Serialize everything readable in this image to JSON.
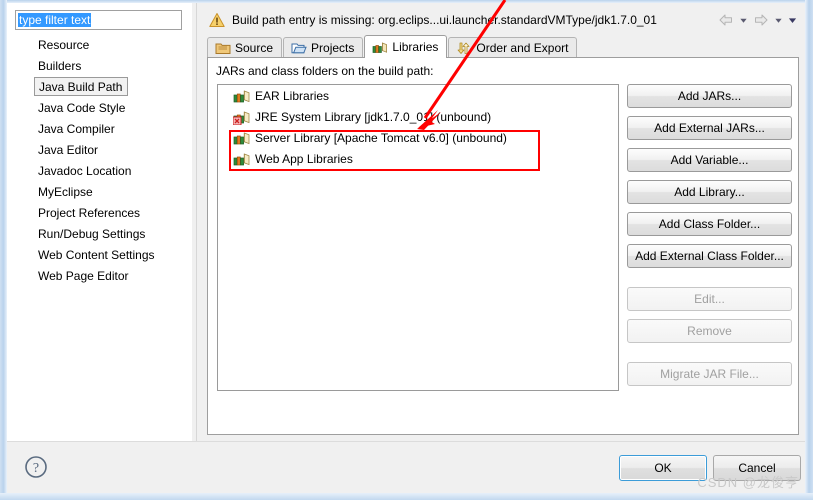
{
  "window": {
    "help_icon": "question-circle-icon",
    "watermark": "CSDN @龙俊亨"
  },
  "sidebar": {
    "filter": {
      "value": "type filter text",
      "placeholder": "type filter text",
      "selected": true
    },
    "items": [
      {
        "label": "Resource",
        "selected": false
      },
      {
        "label": "Builders",
        "selected": false
      },
      {
        "label": "Java Build Path",
        "selected": true
      },
      {
        "label": "Java Code Style",
        "selected": false
      },
      {
        "label": "Java Compiler",
        "selected": false
      },
      {
        "label": "Java Editor",
        "selected": false
      },
      {
        "label": "Javadoc Location",
        "selected": false
      },
      {
        "label": "MyEclipse",
        "selected": false
      },
      {
        "label": "Project References",
        "selected": false
      },
      {
        "label": "Run/Debug Settings",
        "selected": false
      },
      {
        "label": "Web Content Settings",
        "selected": false
      },
      {
        "label": "Web Page Editor",
        "selected": false
      }
    ]
  },
  "message_bar": {
    "icon": "warning-triangle-icon",
    "text": "Build path entry is missing: org.eclips...ui.launcher.standardVMType/jdk1.7.0_01",
    "nav": {
      "back_icon": "back-arrow-icon",
      "back_menu_icon": "chevron-down-icon",
      "forward_icon": "forward-arrow-icon",
      "forward_menu_icon": "chevron-down-icon",
      "more_icon": "chevron-down-icon"
    }
  },
  "tabs": [
    {
      "label": "Source",
      "icon": "source-folder-icon",
      "active": false
    },
    {
      "label": "Projects",
      "icon": "open-folder-icon",
      "active": false
    },
    {
      "label": "Libraries",
      "icon": "books-icon",
      "active": true
    },
    {
      "label": "Order and Export",
      "icon": "order-export-icon",
      "active": false
    }
  ],
  "libraries_tab": {
    "list_label": "JARs and class folders on the build path:",
    "entries": [
      {
        "label": "EAR Libraries",
        "icon": "library-books-icon",
        "error": false
      },
      {
        "label": "JRE System Library [jdk1.7.0_01] (unbound)",
        "icon": "library-books-icon",
        "error": true
      },
      {
        "label": "Server Library [Apache Tomcat v6.0] (unbound)",
        "icon": "library-books-icon",
        "error": false
      },
      {
        "label": "Web App Libraries",
        "icon": "library-books-icon",
        "error": false
      }
    ],
    "buttons": [
      {
        "label": "Add JARs...",
        "enabled": true
      },
      {
        "label": "Add External JARs...",
        "enabled": true
      },
      {
        "label": "Add Variable...",
        "enabled": true
      },
      {
        "label": "Add Library...",
        "enabled": true
      },
      {
        "label": "Add Class Folder...",
        "enabled": true
      },
      {
        "label": "Add External Class Folder...",
        "enabled": true
      },
      {
        "label": "Edit...",
        "enabled": false
      },
      {
        "label": "Remove",
        "enabled": false
      },
      {
        "label": "Migrate JAR File...",
        "enabled": false
      }
    ]
  },
  "footer": {
    "ok_label": "OK",
    "cancel_label": "Cancel"
  },
  "annotation": {
    "highlight_color": "#ff0000",
    "arrow": "red-arrow-pointing-to-jre-system-library"
  }
}
